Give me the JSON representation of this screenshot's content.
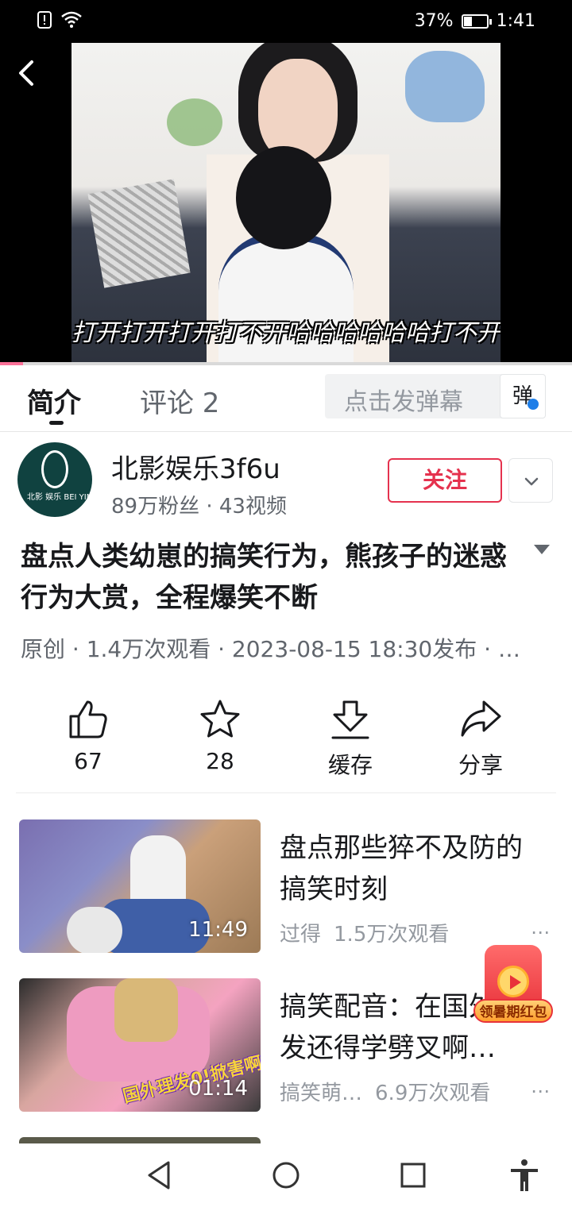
{
  "status_bar": {
    "battery_percent_text": "37%",
    "battery_level": 0.37,
    "time": "1:41",
    "icons": [
      "alert-icon",
      "wifi-icon",
      "battery-icon"
    ]
  },
  "player": {
    "subtitle": "打开打开打开打不开哈哈哈哈哈哈打不开",
    "progress": 0.04,
    "accent_color": "#fb7299"
  },
  "tabs": {
    "intro": "简介",
    "comments": "评论 2"
  },
  "danmaku": {
    "placeholder": "点击发弹幕",
    "button": "弹"
  },
  "uploader": {
    "name": "北影娱乐3f6u",
    "stats": "89万粉丝 · 43视频",
    "follow": "关注",
    "avatar_text": "北影 娱乐 BEI YING YU LE"
  },
  "video": {
    "title": "盘点人类幼崽的搞笑行为，熊孩子的迷惑行为大赏，全程爆笑不断",
    "meta": "原创 · 1.4万次观看 · 2023-08-15 18:30发布 · …"
  },
  "actions": {
    "like": "67",
    "favorite": "28",
    "cache": "缓存",
    "share": "分享"
  },
  "related": [
    {
      "title": "盘点那些猝不及防的搞笑时刻",
      "duration": "11:49",
      "author": "过得",
      "views": "1.5万次观看",
      "more": "⋯"
    },
    {
      "title": "搞笑配音：在国外理发还得学劈叉啊…",
      "duration": "01:14",
      "author": "搞笑萌…",
      "views": "6.9万次观看",
      "more": "⋯",
      "overlay_text": "国外理发0!掀害啊"
    }
  ],
  "red_packet": {
    "label": "领暑期红包"
  },
  "colors": {
    "follow_red": "#e5324e",
    "text_primary": "#18191c",
    "text_secondary": "#61666d"
  }
}
